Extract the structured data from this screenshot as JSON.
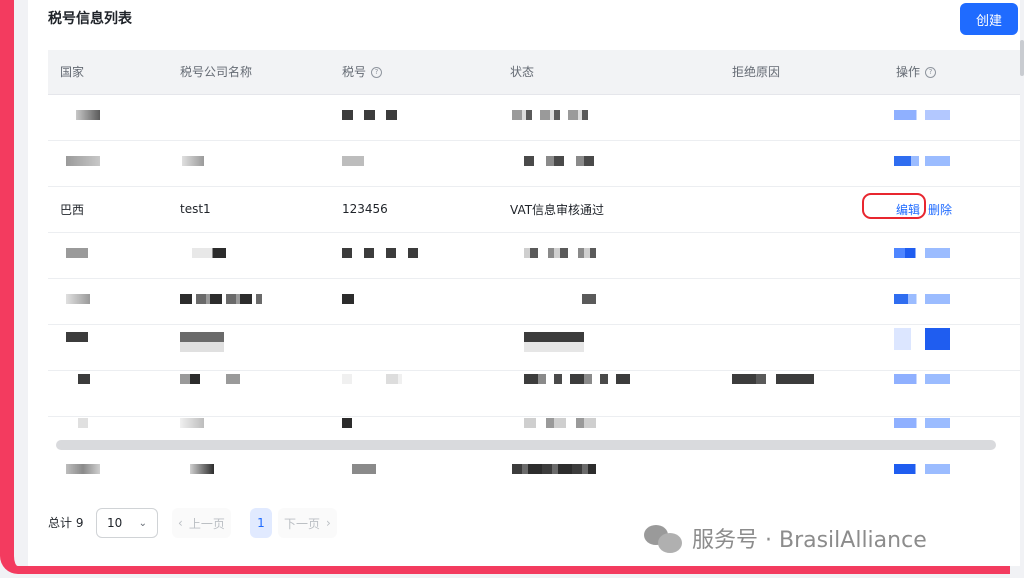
{
  "page": {
    "title": "税号信息列表",
    "create_label": "创建"
  },
  "table": {
    "columns": [
      {
        "label": "国家",
        "help": false
      },
      {
        "label": "税号公司名称",
        "help": false
      },
      {
        "label": "税号",
        "help": true
      },
      {
        "label": "状态",
        "help": false
      },
      {
        "label": "拒绝原因",
        "help": false
      },
      {
        "label": "操作",
        "help": true
      }
    ],
    "help_icon_glyph": "?",
    "visible_row": {
      "country": "巴西",
      "company": "test1",
      "tax_id": "123456",
      "status": "VAT信息审核通过",
      "reject_reason": "",
      "edit_label": "编辑",
      "delete_label": "删除"
    },
    "blurred_row_count": 8
  },
  "pagination": {
    "total_label": "总计 9",
    "page_size": "10",
    "prev_label": "上一页",
    "current_page": "1",
    "next_label": "下一页"
  },
  "watermark": {
    "text": "服务号 · BrasilAlliance"
  },
  "colors": {
    "accent": "#1f6bff",
    "frame": "#f33b5f",
    "highlight": "#e8262f"
  }
}
